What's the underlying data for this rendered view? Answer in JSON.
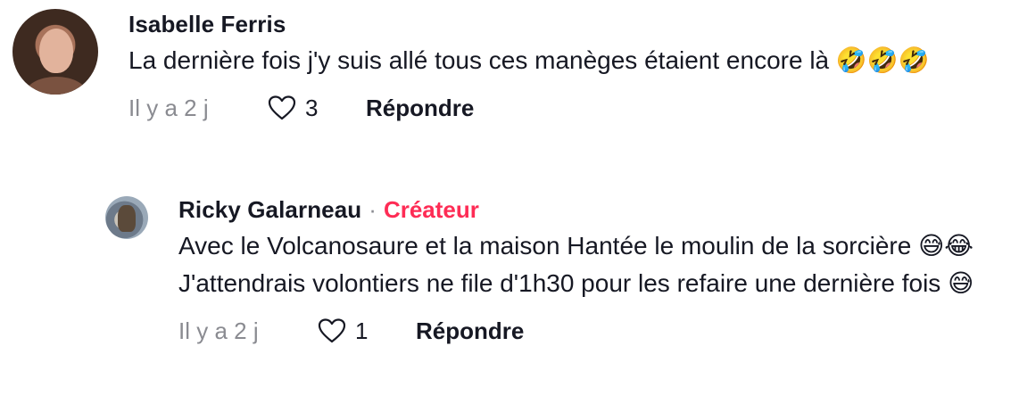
{
  "comments": {
    "top": {
      "username": "Isabelle Ferris",
      "text": "La dernière fois j'y suis allé tous ces manèges étaient encore là 🤣🤣🤣",
      "time": "Il y a 2 j",
      "likes": "3",
      "reply_label": "Répondre",
      "avatar_icon": "user-avatar-photo"
    },
    "reply": {
      "username": "Ricky Galarneau",
      "separator": "·",
      "badge": "Créateur",
      "badge_color": "#fe2c55",
      "text": "Avec le Volcanosaure et la maison Hantée le moulin de la sorcière 😅😂 J'attendrais volontiers ne file d'1h30 pour les refaire une dernière fois 😅",
      "time": "Il y a 2 j",
      "likes": "1",
      "reply_label": "Répondre",
      "avatar_icon": "user-avatar-photo"
    }
  },
  "icons": {
    "like": "heart-outline-icon"
  }
}
